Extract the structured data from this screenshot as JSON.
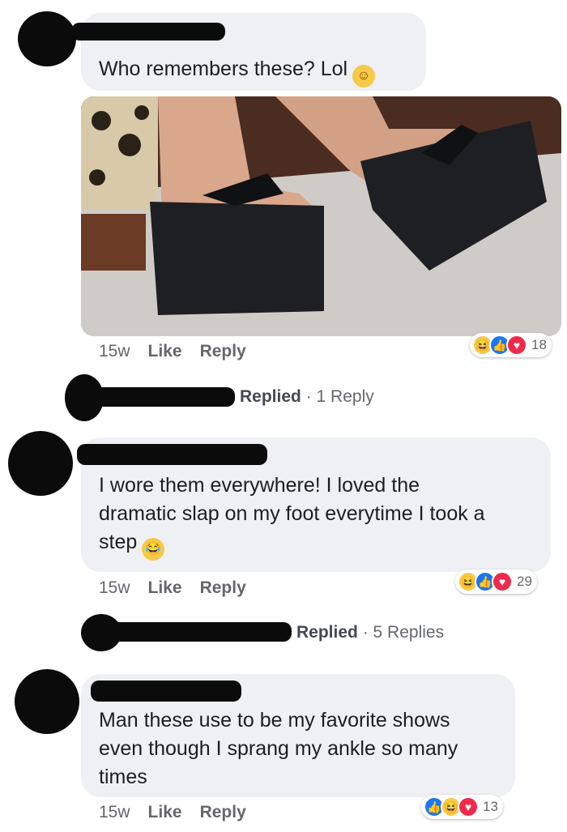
{
  "comments": [
    {
      "text_lines": [
        "Who remembers these? Lol"
      ],
      "emoji": "grinning-face",
      "time": "15w",
      "like_label": "Like",
      "reply_label": "Reply",
      "reaction_count": "18",
      "reactions": [
        "haha",
        "like",
        "love"
      ],
      "replied_label": "Replied",
      "replies_label": "1 Reply"
    },
    {
      "text_lines": [
        "I wore them everywhere! I loved the",
        "dramatic slap on my foot everytime I took a",
        "step"
      ],
      "emoji": "tears-of-joy-face",
      "time": "15w",
      "like_label": "Like",
      "reply_label": "Reply",
      "reaction_count": "29",
      "reactions": [
        "haha",
        "like",
        "love"
      ],
      "replied_label": "Replied",
      "replies_label": "5 Replies"
    },
    {
      "text_lines": [
        "Man these use to be my favorite shows",
        "even though I sprang my ankle so many",
        "times"
      ],
      "time": "15w",
      "like_label": "Like",
      "reply_label": "Reply",
      "reaction_count": "13",
      "reactions": [
        "like",
        "haha",
        "love"
      ]
    }
  ],
  "separator": "·",
  "colors": {
    "bubble": "#eef0f3",
    "meta": "#65676b",
    "like_blue": "#1877f2",
    "love_red": "#f0284a",
    "haha_yellow": "#f7c948"
  }
}
